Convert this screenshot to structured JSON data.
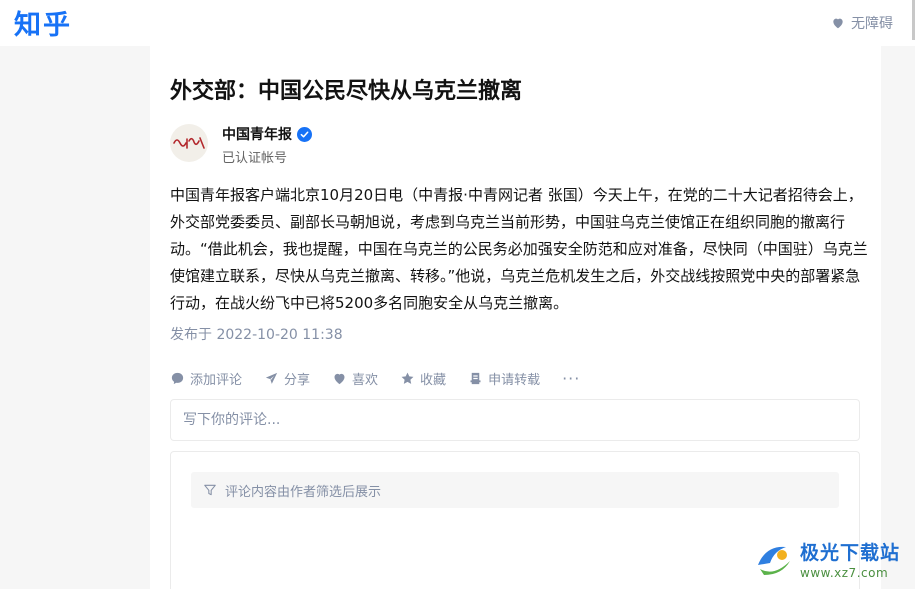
{
  "header": {
    "logo": "知乎",
    "accessibility_label": "无障碍"
  },
  "article": {
    "title": "外交部：中国公民尽快从乌克兰撤离",
    "author": {
      "name": "中国青年报",
      "subtitle": "已认证帐号"
    },
    "body": "中国青年报客户端北京10月20日电（中青报·中青网记者 张国）今天上午，在党的二十大记者招待会上，外交部党委委员、副部长马朝旭说，考虑到乌克兰当前形势，中国驻乌克兰使馆正在组织同胞的撤离行动。“借此机会，我也提醒，中国在乌克兰的公民务必加强安全防范和应对准备，尽快同（中国驻）乌克兰使馆建立联系，尽快从乌克兰撤离、转移。”他说，乌克兰危机发生之后，外交战线按照党中央的部署紧急行动，在战火纷飞中已将5200多名同胞安全从乌克兰撤离。",
    "publish_time": "发布于 2022-10-20 11:38"
  },
  "actions": {
    "comment": "添加评论",
    "share": "分享",
    "like": "喜欢",
    "favorite": "收藏",
    "repost": "申请转载",
    "more": "···"
  },
  "comments": {
    "placeholder": "写下你的评论...",
    "filter_notice": "评论内容由作者筛选后展示"
  },
  "watermark": {
    "title": "极光下载站",
    "url": "www.xz7.com"
  },
  "colors": {
    "brand": "#1772f6",
    "muted": "#8590a6"
  }
}
